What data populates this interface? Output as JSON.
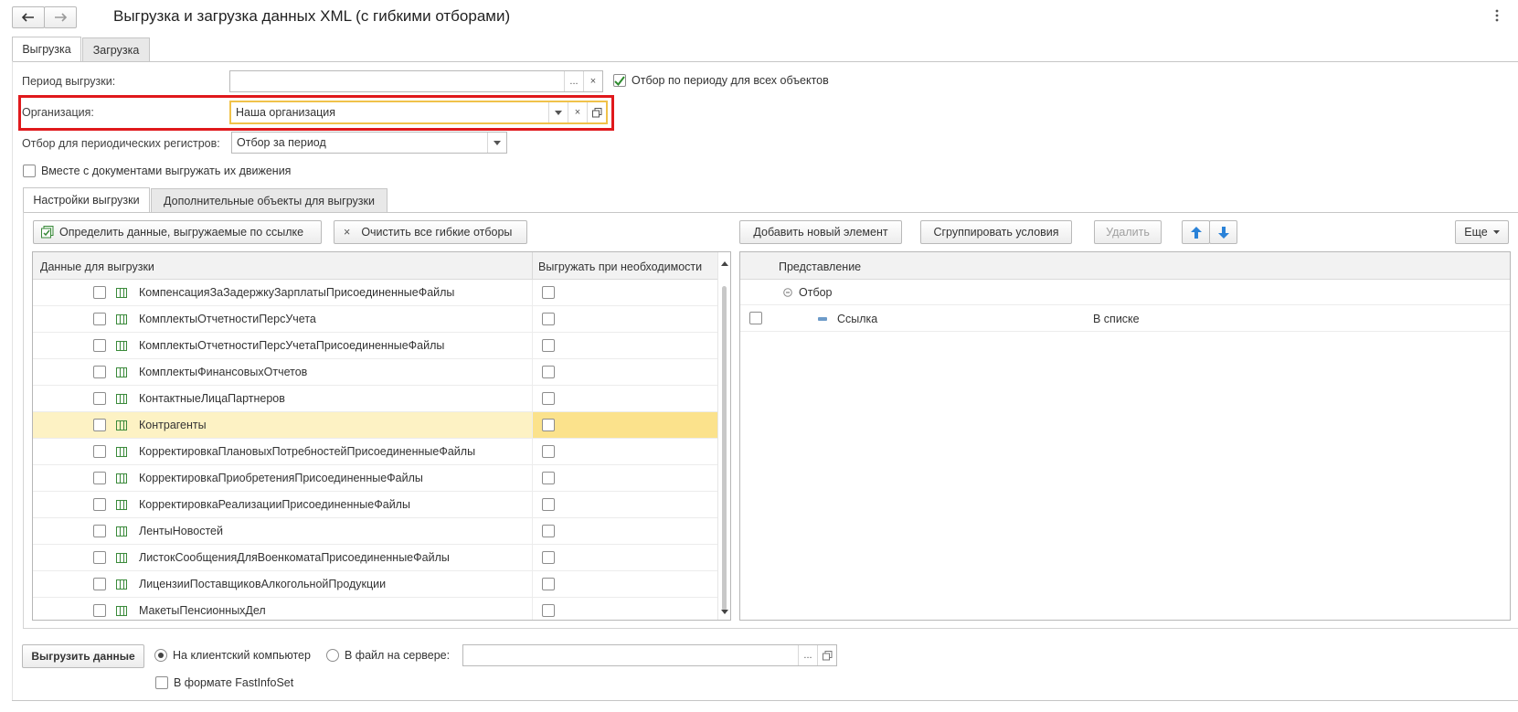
{
  "window": {
    "title": "Выгрузка и загрузка данных XML (с гибкими отборами)",
    "back_icon": "arrow-left-icon",
    "forward_icon": "arrow-right-icon",
    "more_icon": "kebab-menu-icon"
  },
  "tabs": [
    {
      "label": "Выгрузка",
      "active": true
    },
    {
      "label": "Загрузка",
      "active": false
    }
  ],
  "form": {
    "period_label": "Период выгрузки:",
    "period_value": "",
    "period_select_btn": "...",
    "period_clear_btn": "×",
    "period_all_objects_label": "Отбор по периоду для всех объектов",
    "period_all_objects_checked": true,
    "org_label": "Организация:",
    "org_value": "Наша организация",
    "org_clear_btn": "×",
    "periodic_label": "Отбор для периодических регистров:",
    "periodic_value": "Отбор за период",
    "with_movements_label": "Вместе с документами выгружать их движения",
    "with_movements_checked": false
  },
  "inner_tabs": [
    {
      "label": "Настройки выгрузки",
      "active": true
    },
    {
      "label": "Дополнительные объекты для выгрузки",
      "active": false
    }
  ],
  "left_toolbar": {
    "define_btn": "Определить данные, выгружаемые по ссылке",
    "clear_btn": "Очистить все гибкие отборы",
    "clear_icon": "×"
  },
  "left_grid": {
    "col1": "Данные для выгрузки",
    "col2": "Выгружать при необходимости",
    "rows": [
      {
        "name": "КомпенсацияЗаЗадержкуЗарплатыПрисоединенныеФайлы",
        "selected": false
      },
      {
        "name": "КомплектыОтчетностиПерсУчета",
        "selected": false
      },
      {
        "name": "КомплектыОтчетностиПерсУчетаПрисоединенныеФайлы",
        "selected": false
      },
      {
        "name": "КомплектыФинансовыхОтчетов",
        "selected": false
      },
      {
        "name": "КонтактныеЛицаПартнеров",
        "selected": false
      },
      {
        "name": "Контрагенты",
        "selected": true
      },
      {
        "name": "КорректировкаПлановыхПотребностейПрисоединенныеФайлы",
        "selected": false
      },
      {
        "name": "КорректировкаПриобретенияПрисоединенныеФайлы",
        "selected": false
      },
      {
        "name": "КорректировкаРеализацииПрисоединенныеФайлы",
        "selected": false
      },
      {
        "name": "ЛентыНовостей",
        "selected": false
      },
      {
        "name": "ЛистокСообщенияДляВоенкоматаПрисоединенныеФайлы",
        "selected": false
      },
      {
        "name": "ЛицензииПоставщиковАлкогольнойПродукции",
        "selected": false
      },
      {
        "name": "МакетыПенсионныхДел",
        "selected": false
      }
    ]
  },
  "right_toolbar": {
    "add_btn": "Добавить новый элемент",
    "group_btn": "Сгруппировать условия",
    "delete_btn": "Удалить",
    "more_btn": "Еще"
  },
  "right_grid": {
    "col1": "Представление",
    "group_row": "Отбор",
    "item_name": "Ссылка",
    "item_condition": "В списке"
  },
  "bottom": {
    "export_btn": "Выгрузить данные",
    "to_client_label": "На клиентский компьютер",
    "to_server_label": "В файл на сервере:",
    "server_path": "",
    "server_select_btn": "...",
    "fastinfoset_label": "В формате FastInfoSet"
  },
  "colors": {
    "highlight_border": "#e0191c",
    "focus_border": "#f0c24a",
    "selected_row": "#fdf2c4",
    "selected_cell": "#fbe28c",
    "checkmark": "#2e8b2e",
    "arrow_blue": "#2a82d8"
  }
}
